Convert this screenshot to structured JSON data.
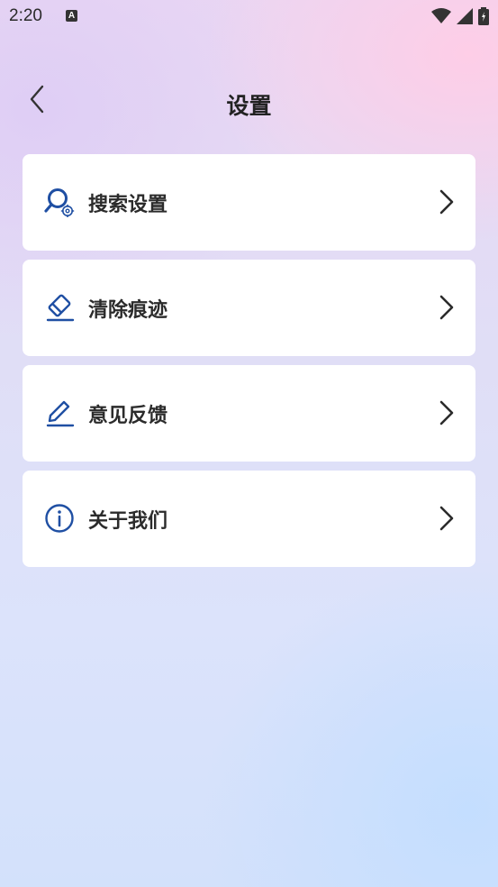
{
  "status": {
    "time": "2:20",
    "notification_badge": "A"
  },
  "header": {
    "title": "设置",
    "back_icon": "chevron-left-icon"
  },
  "menu": [
    {
      "label": "搜索设置",
      "icon": "search-settings-icon"
    },
    {
      "label": "清除痕迹",
      "icon": "eraser-icon"
    },
    {
      "label": "意见反馈",
      "icon": "pencil-feedback-icon"
    },
    {
      "label": "关于我们",
      "icon": "info-icon"
    }
  ],
  "colors": {
    "icon_blue": "#1f4fa3",
    "text": "#2b2b2b",
    "card_bg": "#ffffff"
  }
}
